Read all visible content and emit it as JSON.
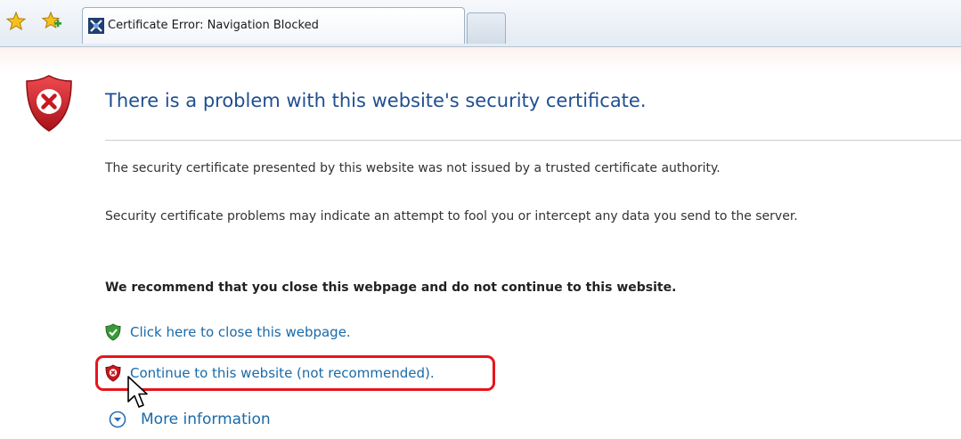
{
  "toolbar": {
    "favorites_icon": "star-icon",
    "add_favorites_icon": "add-to-favorites-icon"
  },
  "tabs": [
    {
      "title": "Certificate Error: Navigation Blocked",
      "icon": "certificate-error-icon",
      "active": true
    },
    {
      "title": "",
      "icon": "new-tab",
      "active": false
    }
  ],
  "page": {
    "headline": "There is a problem with this website's security certificate.",
    "paragraph_1": "The security certificate presented by this website was not issued by a trusted certificate authority.",
    "paragraph_2": "Security certificate problems may indicate an attempt to fool you or intercept any data you send to the server.",
    "recommendation": "We recommend that you close this webpage and do not continue to this website.",
    "close_link": "Click here to close this webpage.",
    "continue_link": "Continue to this website (not recommended).",
    "more_info": "More information"
  },
  "colors": {
    "headline": "#1f4f8f",
    "link": "#1a6aa8",
    "highlight": "#e8141c",
    "shield_red": "#c8171e",
    "shield_green": "#3a9a3a"
  }
}
